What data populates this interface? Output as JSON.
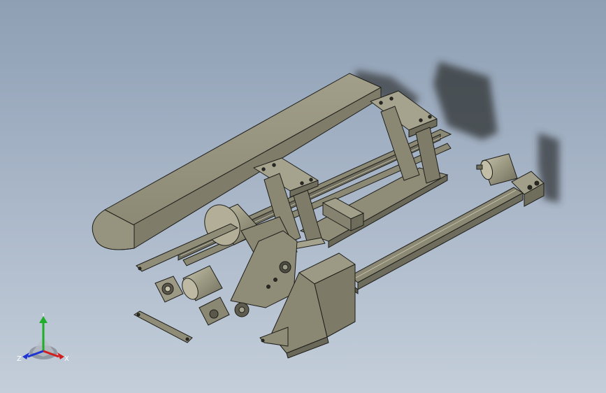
{
  "scene": {
    "background_top": "#8e9fb4",
    "background_bottom": "#c4ceda",
    "part_color": "#8a8773",
    "part_dark": "#5f5d4e",
    "part_light": "#a9a692",
    "edge_color": "#1e1e1a"
  },
  "triad": {
    "x_label": "X",
    "y_label": "Y",
    "z_label": "Z",
    "x_color": "#d11f1f",
    "y_color": "#1fae2a",
    "z_color": "#1f35d1"
  }
}
